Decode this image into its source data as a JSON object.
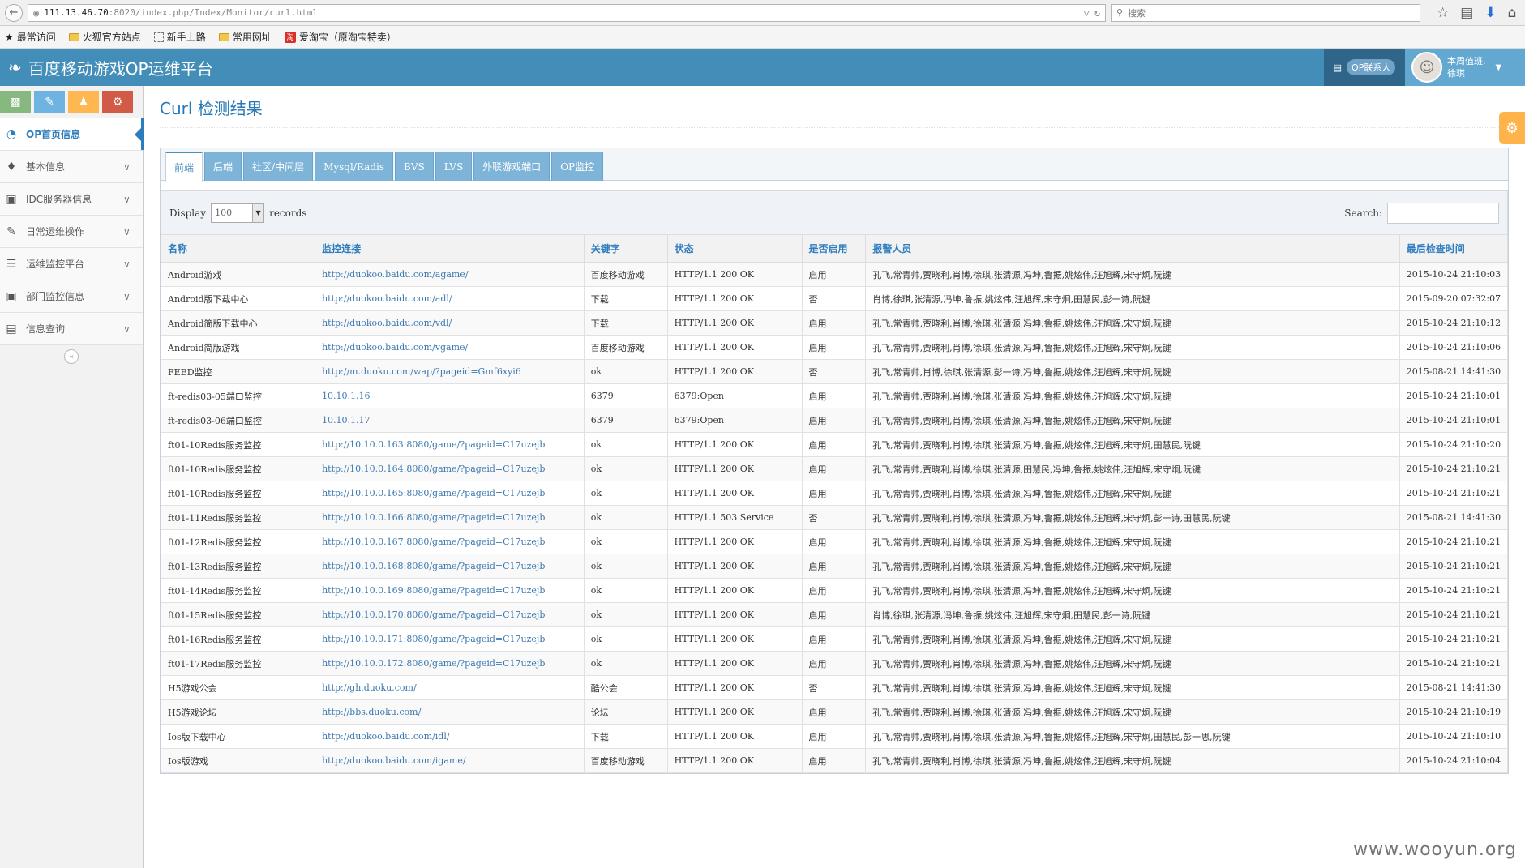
{
  "browser": {
    "url_host": "111.13.46.70",
    "url_path": ":8020/index.php/Index/Monitor/curl.html",
    "search_placeholder": "搜索",
    "bookmarks": [
      "最常访问",
      "火狐官方站点",
      "新手上路",
      "常用网址",
      "爱淘宝（原淘宝特卖）"
    ]
  },
  "header": {
    "brand": "百度移动游戏OP运维平台",
    "op_contact": "OP联系人",
    "greeting": "本周值班,",
    "user": "徐琪"
  },
  "sidebar": {
    "items": [
      {
        "label": "OP首页信息",
        "icon": "dashboard-icon"
      },
      {
        "label": "基本信息",
        "icon": "tag-icon"
      },
      {
        "label": "IDC服务器信息",
        "icon": "desktop-icon"
      },
      {
        "label": "日常运维操作",
        "icon": "edit-icon"
      },
      {
        "label": "运维监控平台",
        "icon": "list-icon"
      },
      {
        "label": "部门监控信息",
        "icon": "desktop-icon"
      },
      {
        "label": "信息查询",
        "icon": "list-alt-icon"
      }
    ]
  },
  "page": {
    "title": "Curl 检测结果",
    "tabs": [
      "前端",
      "后端",
      "社区/中间层",
      "Mysql/Radis",
      "BVS",
      "LVS",
      "外联游戏端口",
      "OP监控"
    ],
    "display_label": "Display",
    "records_label": "records",
    "page_size": "100",
    "search_label": "Search:"
  },
  "table": {
    "columns": [
      "名称",
      "监控连接",
      "关键字",
      "状态",
      "是否启用",
      "报警人员",
      "最后检查时间"
    ],
    "rows": [
      [
        "Android游戏",
        "http://duokoo.baidu.com/agame/",
        "百度移动游戏",
        "HTTP/1.1 200 OK",
        "启用",
        "孔飞,常青帅,贾晓利,肖博,徐琪,张清源,冯坤,鲁振,姚炫伟,汪旭辉,宋守炯,阮键",
        "2015-10-24 21:10:03"
      ],
      [
        "Android版下载中心",
        "http://duokoo.baidu.com/adl/",
        "下载",
        "HTTP/1.1 200 OK",
        "否",
        "肖博,徐琪,张清源,冯坤,鲁振,姚炫伟,汪旭辉,宋守炯,田慧民,彭一诗,阮键",
        "2015-09-20 07:32:07"
      ],
      [
        "Android简版下载中心",
        "http://duokoo.baidu.com/vdl/",
        "下载",
        "HTTP/1.1 200 OK",
        "启用",
        "孔飞,常青帅,贾晓利,肖博,徐琪,张清源,冯坤,鲁振,姚炫伟,汪旭辉,宋守炯,阮键",
        "2015-10-24 21:10:12"
      ],
      [
        "Android简版游戏",
        "http://duokoo.baidu.com/vgame/",
        "百度移动游戏",
        "HTTP/1.1 200 OK",
        "启用",
        "孔飞,常青帅,贾晓利,肖博,徐琪,张清源,冯坤,鲁振,姚炫伟,汪旭辉,宋守炯,阮键",
        "2015-10-24 21:10:06"
      ],
      [
        "FEED监控",
        "http://m.duoku.com/wap/?pageid=Gmf6xyi6",
        "ok",
        "HTTP/1.1 200 OK",
        "否",
        "孔飞,常青帅,肖博,徐琪,张清源,彭一诗,冯坤,鲁振,姚炫伟,汪旭辉,宋守炯,阮键",
        "2015-08-21 14:41:30"
      ],
      [
        "ft-redis03-05端口监控",
        "10.10.1.16",
        "6379",
        "6379:Open",
        "启用",
        "孔飞,常青帅,贾晓利,肖博,徐琪,张清源,冯坤,鲁振,姚炫伟,汪旭辉,宋守炯,阮键",
        "2015-10-24 21:10:01"
      ],
      [
        "ft-redis03-06端口监控",
        "10.10.1.17",
        "6379",
        "6379:Open",
        "启用",
        "孔飞,常青帅,贾晓利,肖博,徐琪,张清源,冯坤,鲁振,姚炫伟,汪旭辉,宋守炯,阮键",
        "2015-10-24 21:10:01"
      ],
      [
        "ft01-10Redis服务监控",
        "http://10.10.0.163:8080/game/?pageid=C17uzejb",
        "ok",
        "HTTP/1.1 200 OK",
        "启用",
        "孔飞,常青帅,贾晓利,肖博,徐琪,张清源,冯坤,鲁振,姚炫伟,汪旭辉,宋守炯,田慧民,阮键",
        "2015-10-24 21:10:20"
      ],
      [
        "ft01-10Redis服务监控",
        "http://10.10.0.164:8080/game/?pageid=C17uzejb",
        "ok",
        "HTTP/1.1 200 OK",
        "启用",
        "孔飞,常青帅,贾晓利,肖博,徐琪,张清源,田慧民,冯坤,鲁振,姚炫伟,汪旭辉,宋守炯,阮键",
        "2015-10-24 21:10:21"
      ],
      [
        "ft01-10Redis服务监控",
        "http://10.10.0.165:8080/game/?pageid=C17uzejb",
        "ok",
        "HTTP/1.1 200 OK",
        "启用",
        "孔飞,常青帅,贾晓利,肖博,徐琪,张清源,冯坤,鲁振,姚炫伟,汪旭辉,宋守炯,阮键",
        "2015-10-24 21:10:21"
      ],
      [
        "ft01-11Redis服务监控",
        "http://10.10.0.166:8080/game/?pageid=C17uzejb",
        "ok",
        "HTTP/1.1 503 Service",
        "否",
        "孔飞,常青帅,贾晓利,肖博,徐琪,张清源,冯坤,鲁振,姚炫伟,汪旭辉,宋守炯,彭一诗,田慧民,阮键",
        "2015-08-21 14:41:30"
      ],
      [
        "ft01-12Redis服务监控",
        "http://10.10.0.167:8080/game/?pageid=C17uzejb",
        "ok",
        "HTTP/1.1 200 OK",
        "启用",
        "孔飞,常青帅,贾晓利,肖博,徐琪,张清源,冯坤,鲁振,姚炫伟,汪旭辉,宋守炯,阮键",
        "2015-10-24 21:10:21"
      ],
      [
        "ft01-13Redis服务监控",
        "http://10.10.0.168:8080/game/?pageid=C17uzejb",
        "ok",
        "HTTP/1.1 200 OK",
        "启用",
        "孔飞,常青帅,贾晓利,肖博,徐琪,张清源,冯坤,鲁振,姚炫伟,汪旭辉,宋守炯,阮键",
        "2015-10-24 21:10:21"
      ],
      [
        "ft01-14Redis服务监控",
        "http://10.10.0.169:8080/game/?pageid=C17uzejb",
        "ok",
        "HTTP/1.1 200 OK",
        "启用",
        "孔飞,常青帅,贾晓利,肖博,徐琪,张清源,冯坤,鲁振,姚炫伟,汪旭辉,宋守炯,阮键",
        "2015-10-24 21:10:21"
      ],
      [
        "ft01-15Redis服务监控",
        "http://10.10.0.170:8080/game/?pageid=C17uzejb",
        "ok",
        "HTTP/1.1 200 OK",
        "启用",
        "肖博,徐琪,张清源,冯坤,鲁振,姚炫伟,汪旭辉,宋守炯,田慧民,彭一诗,阮键",
        "2015-10-24 21:10:21"
      ],
      [
        "ft01-16Redis服务监控",
        "http://10.10.0.171:8080/game/?pageid=C17uzejb",
        "ok",
        "HTTP/1.1 200 OK",
        "启用",
        "孔飞,常青帅,贾晓利,肖博,徐琪,张清源,冯坤,鲁振,姚炫伟,汪旭辉,宋守炯,阮键",
        "2015-10-24 21:10:21"
      ],
      [
        "ft01-17Redis服务监控",
        "http://10.10.0.172:8080/game/?pageid=C17uzejb",
        "ok",
        "HTTP/1.1 200 OK",
        "启用",
        "孔飞,常青帅,贾晓利,肖博,徐琪,张清源,冯坤,鲁振,姚炫伟,汪旭辉,宋守炯,阮键",
        "2015-10-24 21:10:21"
      ],
      [
        "H5游戏公会",
        "http://gh.duoku.com/",
        "酷公会",
        "HTTP/1.1 200 OK",
        "否",
        "孔飞,常青帅,贾晓利,肖博,徐琪,张清源,冯坤,鲁振,姚炫伟,汪旭辉,宋守炯,阮键",
        "2015-08-21 14:41:30"
      ],
      [
        "H5游戏论坛",
        "http://bbs.duoku.com/",
        "论坛",
        "HTTP/1.1 200 OK",
        "启用",
        "孔飞,常青帅,贾晓利,肖博,徐琪,张清源,冯坤,鲁振,姚炫伟,汪旭辉,宋守炯,阮键",
        "2015-10-24 21:10:19"
      ],
      [
        "Ios版下载中心",
        "http://duokoo.baidu.com/idl/",
        "下载",
        "HTTP/1.1 200 OK",
        "启用",
        "孔飞,常青帅,贾晓利,肖博,徐琪,张清源,冯坤,鲁振,姚炫伟,汪旭辉,宋守炯,田慧民,彭一思,阮键",
        "2015-10-24 21:10:10"
      ],
      [
        "Ios版游戏",
        "http://duokoo.baidu.com/igame/",
        "百度移动游戏",
        "HTTP/1.1 200 OK",
        "启用",
        "孔飞,常青帅,贾晓利,肖博,徐琪,张清源,冯坤,鲁振,姚炫伟,汪旭辉,宋守炯,阮键",
        "2015-10-24 21:10:04"
      ]
    ]
  },
  "watermark": "www.wooyun.org",
  "colors": {
    "header": "#438eb9",
    "accent": "#2b7dbc",
    "tab": "#7db4d8",
    "link": "#3b78b0"
  }
}
